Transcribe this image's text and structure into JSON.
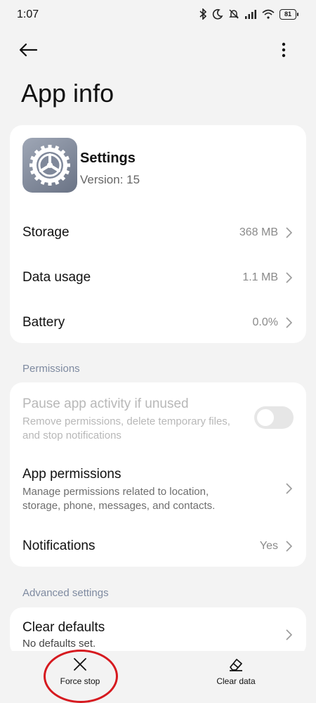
{
  "status_bar": {
    "time": "1:07",
    "battery": "81"
  },
  "header": {
    "title": "App info"
  },
  "app": {
    "name": "Settings",
    "version": "Version: 15"
  },
  "stats": [
    {
      "label": "Storage",
      "value": "368 MB"
    },
    {
      "label": "Data usage",
      "value": "1.1 MB"
    },
    {
      "label": "Battery",
      "value": "0.0%"
    }
  ],
  "permissions_section": {
    "title": "Permissions",
    "pause": {
      "title": "Pause app activity if unused",
      "subtitle_line1": "Remove permissions, delete temporary files,",
      "subtitle_line2": "and stop notifications",
      "enabled": false
    },
    "app_permissions": {
      "title": "App permissions",
      "subtitle_line1": "Manage permissions related to location,",
      "subtitle_line2": "storage, phone, messages, and contacts."
    },
    "notifications": {
      "title": "Notifications",
      "value": "Yes"
    }
  },
  "advanced_section": {
    "title": "Advanced settings",
    "clear_defaults": {
      "title": "Clear defaults",
      "subtitle": "No defaults set."
    }
  },
  "bottom_bar": {
    "force_stop": "Force stop",
    "clear_data": "Clear data"
  },
  "colors": {
    "highlight": "#d6191f",
    "section_label": "#7e8aa0"
  }
}
